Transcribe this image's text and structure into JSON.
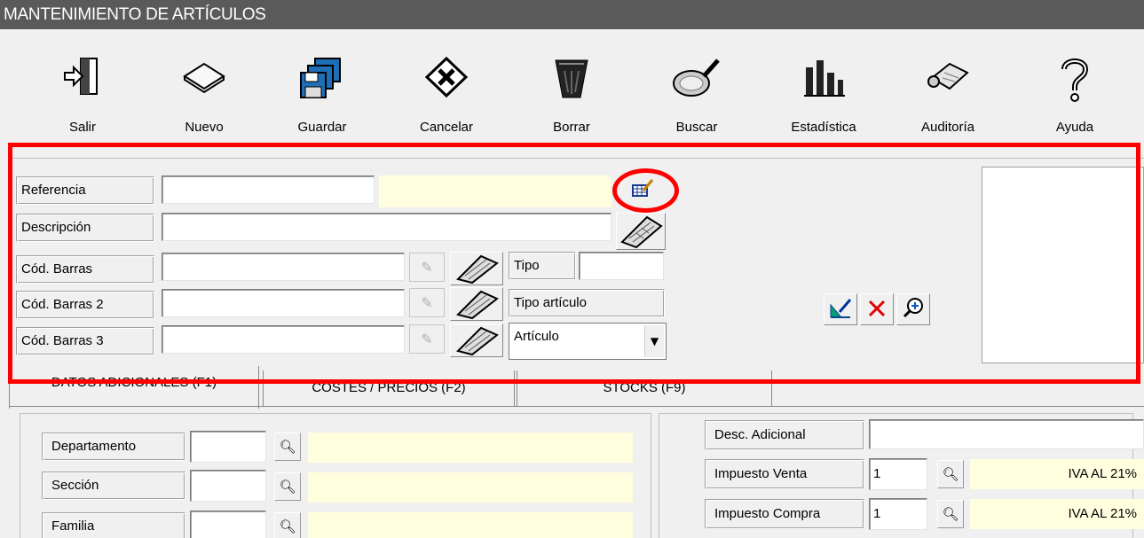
{
  "window": {
    "title": "MANTENIMIENTO DE ARTÍCULOS"
  },
  "toolbar": [
    {
      "label": "Salir",
      "icon": "exit-door-icon"
    },
    {
      "label": "Nuevo",
      "icon": "new-document-icon"
    },
    {
      "label": "Guardar",
      "icon": "save-disks-icon"
    },
    {
      "label": "Cancelar",
      "icon": "cancel-x-icon"
    },
    {
      "label": "Borrar",
      "icon": "trash-bin-icon"
    },
    {
      "label": "Buscar",
      "icon": "magnifier-icon"
    },
    {
      "label": "Estadística",
      "icon": "bar-chart-icon"
    },
    {
      "label": "Auditoría",
      "icon": "audit-scroll-icon"
    },
    {
      "label": "Ayuda",
      "icon": "help-question-icon"
    }
  ],
  "form": {
    "referencia": {
      "label": "Referencia",
      "value": ""
    },
    "descripcion": {
      "label": "Descripción",
      "value": ""
    },
    "cod_barras": {
      "label": "Cód. Barras",
      "value": ""
    },
    "cod_barras2": {
      "label": "Cód. Barras 2",
      "value": ""
    },
    "cod_barras3": {
      "label": "Cód. Barras 3",
      "value": ""
    },
    "tipo": {
      "label": "Tipo",
      "value": ""
    },
    "tipo_articulo": {
      "label": "Tipo artículo",
      "selected": "Artículo"
    }
  },
  "tabs": [
    {
      "label": "DATOS ADICIONALES (F1)"
    },
    {
      "label": "COSTES / PRECIOS (F2)"
    },
    {
      "label": "STOCKS (F9)"
    }
  ],
  "left_panel": {
    "departamento": {
      "label": "Departamento",
      "value": ""
    },
    "seccion": {
      "label": "Sección",
      "value": ""
    },
    "familia": {
      "label": "Familia",
      "value": ""
    }
  },
  "right_panel": {
    "desc_adicional": {
      "label": "Desc. Adicional",
      "value": ""
    },
    "impuesto_venta": {
      "label": "Impuesto Venta",
      "value": "1",
      "desc": "IVA AL 21%"
    },
    "impuesto_compra": {
      "label": "Impuesto Compra",
      "value": "1",
      "desc": "IVA AL 21%"
    }
  },
  "colors": {
    "highlight": "#ff0000",
    "cream": "#ffffe0",
    "titlebar": "#5a5a5a"
  }
}
